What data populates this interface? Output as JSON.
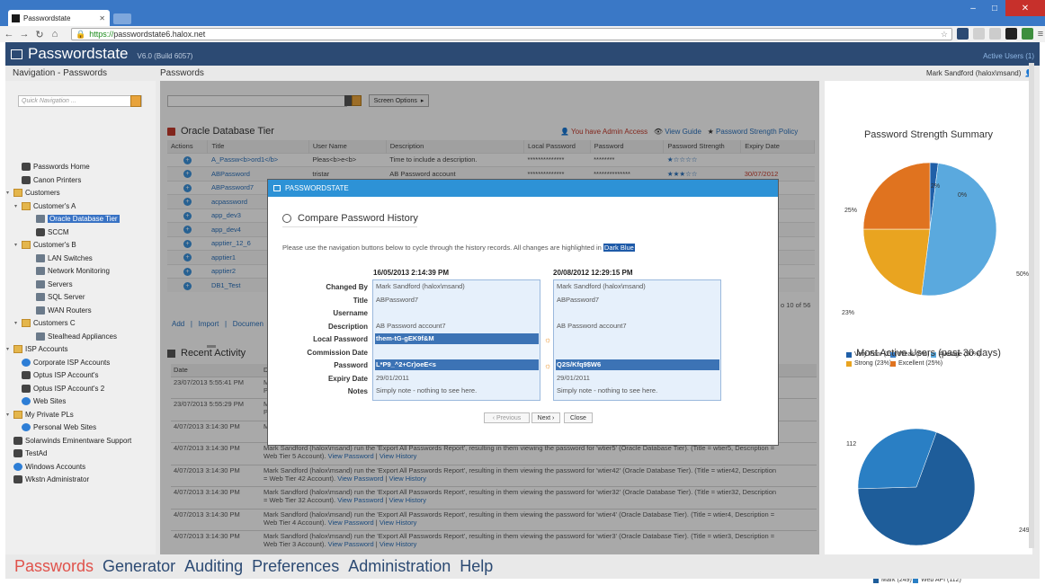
{
  "browser": {
    "tab_title": "Passwordstate",
    "url_scheme": "https://",
    "url_host": "passwordstate6.halox.net"
  },
  "app": {
    "brand": "Passwordstate",
    "version": "V6.0 (Build 6057)",
    "active_users": "Active Users (1)",
    "nav_header": "Navigation - Passwords",
    "main_header": "Passwords",
    "user": "Mark Sandford (halox\\msand)"
  },
  "sidebar": {
    "quick_nav_placeholder": "Quick Navigation ...",
    "items": [
      {
        "label": "Passwords Home",
        "icon": "passwords-home-icon"
      },
      {
        "label": "Canon Printers",
        "icon": "key-icon"
      },
      {
        "label": "Customers",
        "icon": "folder-icon"
      },
      {
        "label": "Customer's A",
        "icon": "folder-icon"
      },
      {
        "label": "Oracle Database Tier",
        "icon": "database-icon"
      },
      {
        "label": "SCCM",
        "icon": "key-icon"
      },
      {
        "label": "Customer's B",
        "icon": "folder-icon"
      },
      {
        "label": "LAN Switches",
        "icon": "network-icon"
      },
      {
        "label": "Network Monitoring",
        "icon": "network-icon"
      },
      {
        "label": "Servers",
        "icon": "server-icon"
      },
      {
        "label": "SQL Server",
        "icon": "database-icon"
      },
      {
        "label": "WAN Routers",
        "icon": "network-icon"
      },
      {
        "label": "Customers C",
        "icon": "folder-icon"
      },
      {
        "label": "Stealhead Appliances",
        "icon": "network-icon"
      },
      {
        "label": "ISP Accounts",
        "icon": "folder-icon"
      },
      {
        "label": "Corporate ISP Accounts",
        "icon": "globe-icon"
      },
      {
        "label": "Optus ISP Account's",
        "icon": "key-icon"
      },
      {
        "label": "Optus ISP Account's 2",
        "icon": "key-icon"
      },
      {
        "label": "Web Sites",
        "icon": "globe-icon"
      },
      {
        "label": "My Private PLs",
        "icon": "folder-icon"
      },
      {
        "label": "Personal Web Sites",
        "icon": "globe-icon"
      },
      {
        "label": "Solarwinds Eminentware Support",
        "icon": "key-icon"
      },
      {
        "label": "TestAd",
        "icon": "key-icon"
      },
      {
        "label": "Windows Accounts",
        "icon": "windows-icon"
      },
      {
        "label": "Wkstn Administrator",
        "icon": "key-icon"
      }
    ]
  },
  "main": {
    "screen_options": "Screen Options",
    "table_title": "Oracle Database Tier",
    "admin_access": "You have Admin Access",
    "view_guide": "View Guide",
    "strength_policy": "Password Strength Policy",
    "columns": [
      "Actions",
      "Title",
      "User Name",
      "Description",
      "Local Password",
      "Password",
      "Password Strength",
      "Expiry Date"
    ],
    "rows": [
      {
        "title": "A_Passw<b>ord1</b>",
        "user": "Pleas<b>e<b>",
        "desc": "Time to include a description.",
        "local": "**************",
        "pwd": "********",
        "strength": 1,
        "expiry": ""
      },
      {
        "title": "ABPassword",
        "user": "tristar",
        "desc": "AB Password account",
        "local": "**************",
        "pwd": "**************",
        "strength": 3,
        "expiry": "30/07/2012"
      },
      {
        "title": "ABPassword7",
        "user": "",
        "desc": "",
        "local": "",
        "pwd": "",
        "strength": 0,
        "expiry": ""
      },
      {
        "title": "acpassword",
        "user": "",
        "desc": "",
        "local": "",
        "pwd": "",
        "strength": 0,
        "expiry": ""
      },
      {
        "title": "app_dev3",
        "user": "",
        "desc": "",
        "local": "",
        "pwd": "",
        "strength": 0,
        "expiry": ""
      },
      {
        "title": "app_dev4",
        "user": "",
        "desc": "",
        "local": "",
        "pwd": "",
        "strength": 0,
        "expiry": ""
      },
      {
        "title": "apptier_12_6",
        "user": "",
        "desc": "",
        "local": "",
        "pwd": "",
        "strength": 0,
        "expiry": ""
      },
      {
        "title": "apptier1",
        "user": "",
        "desc": "",
        "local": "",
        "pwd": "",
        "strength": 0,
        "expiry": ""
      },
      {
        "title": "apptier2",
        "user": "",
        "desc": "",
        "local": "",
        "pwd": "",
        "strength": 0,
        "expiry": ""
      },
      {
        "title": "DB1_Test",
        "user": "",
        "desc": "",
        "local": "",
        "pwd": "",
        "strength": 0,
        "expiry": ""
      }
    ],
    "pager": "o 10 of 56",
    "links": {
      "add": "Add",
      "import": "Import",
      "documents": "Documen"
    },
    "recent_title": "Recent Activity",
    "recent_columns": [
      "Date",
      "D"
    ],
    "recent": [
      {
        "date": "23/07/2013 5:55:41 PM",
        "text": "M",
        "text2": "P",
        "l1": "",
        "l2": ""
      },
      {
        "date": "23/07/2013 5:55:29 PM",
        "text": "Ma",
        "text2": "P",
        "l1": "",
        "l2": ""
      },
      {
        "date": "4/07/2013 3:14:30 PM",
        "text": "M",
        "text2": "",
        "l1": "",
        "l2": ""
      },
      {
        "date": "4/07/2013 3:14:30 PM",
        "text": "Mark Sandford (halox\\msand) run the 'Export All Passwords Report', resulting in them viewing the password for 'wtier5' (Oracle Database Tier). (Title = wtier5, Description =",
        "text2": "Web Tier 5 Account).",
        "l1": "View Password",
        "l2": "View History"
      },
      {
        "date": "4/07/2013 3:14:30 PM",
        "text": "Mark Sandford (halox\\msand) run the 'Export All Passwords Report', resulting in them viewing the password for 'wtier42' (Oracle Database Tier). (Title = wtier42, Description",
        "text2": "= Web Tier 42 Account).",
        "l1": "View Password",
        "l2": "View History"
      },
      {
        "date": "4/07/2013 3:14:30 PM",
        "text": "Mark Sandford (halox\\msand) run the 'Export All Passwords Report', resulting in them viewing the password for 'wtier32' (Oracle Database Tier). (Title = wtier32, Description",
        "text2": "= Web Tier 32 Account).",
        "l1": "View Password",
        "l2": "View History"
      },
      {
        "date": "4/07/2013 3:14:30 PM",
        "text": "Mark Sandford (halox\\msand) run the 'Export All Passwords Report', resulting in them viewing the password for 'wtier4' (Oracle Database Tier). (Title = wtier4, Description =",
        "text2": "Web Tier 4 Account).",
        "l1": "View Password",
        "l2": "View History"
      },
      {
        "date": "4/07/2013 3:14:30 PM",
        "text": "Mark Sandford (halox\\msand) run the 'Export All Passwords Report', resulting in them viewing the password for 'wtier3' (Oracle Database Tier). (Title = wtier3, Description =",
        "text2": "Web Tier 3 Account).",
        "l1": "View Password",
        "l2": "View History"
      }
    ]
  },
  "modal": {
    "header": "PASSWORDSTATE",
    "title": "Compare Password History",
    "desc": "Please use the navigation buttons below to cycle through the history records. All changes are highlighted in",
    "desc_hl": "Dark Blue",
    "labels": [
      "Changed By",
      "Title",
      "Username",
      "Description",
      "Local Password",
      "Commission Date",
      "Password",
      "Expiry Date",
      "Notes"
    ],
    "left": {
      "date": "16/05/2013 2:14:39 PM",
      "values": [
        "Mark Sandford (halox\\msand)",
        "ABPassword7",
        "",
        "AB Password account7",
        "them-tG-gEK9f&M",
        "",
        "L*P9_^2+Cr)oeE<s",
        "29/01/2011",
        "Simply note - nothing to see here."
      ]
    },
    "right": {
      "date": "20/08/2012 12:29:15 PM",
      "values": [
        "Mark Sandford (halox\\msand)",
        "ABPassword7",
        "",
        "AB Password account7",
        "",
        "",
        "Q2S/Kfq9$W6",
        "29/01/2011",
        "Simply note - nothing to see here."
      ]
    },
    "highlight_rows": [
      4,
      6
    ],
    "btn_prev": "Previous",
    "btn_next": "Next",
    "btn_close": "Close"
  },
  "right_panel": {
    "strength_title": "Password Strength Summary",
    "users_title": "Most Active Users (past 30 days)"
  },
  "chart_data": [
    {
      "type": "pie",
      "title": "Password Strength Summary",
      "categories": [
        "Very Poor (2%)",
        "Weak (0%)",
        "Average (50%)",
        "Strong (23%)",
        "Excellent (25%)"
      ],
      "values": [
        2,
        0,
        50,
        23,
        25
      ],
      "colors": [
        "#1f5fa8",
        "#3b7fc8",
        "#5aa9de",
        "#e9a420",
        "#e0731f"
      ],
      "slice_labels": [
        "2%",
        "0%",
        "50%",
        "23%",
        "25%"
      ],
      "legend": "bottom"
    },
    {
      "type": "pie",
      "title": "Most Active Users (past 30 days)",
      "categories": [
        "Mark (249)",
        "Web API (112)"
      ],
      "values": [
        249,
        112
      ],
      "colors": [
        "#1e5d9a",
        "#2a7fc4"
      ],
      "slice_labels": [
        "249",
        "112"
      ],
      "legend": "bottom"
    }
  ],
  "bottom_nav": [
    "Passwords",
    "Generator",
    "Auditing",
    "Preferences",
    "Administration",
    "Help"
  ]
}
